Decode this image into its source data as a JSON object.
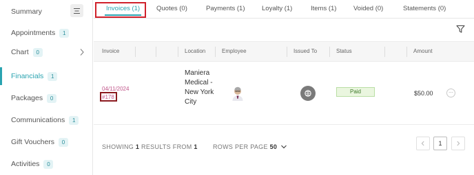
{
  "sidebar": {
    "items": [
      {
        "label": "Summary",
        "badge": null
      },
      {
        "label": "Appointments",
        "badge": "1"
      },
      {
        "label": "Chart",
        "badge": "0"
      },
      {
        "label": "Financials",
        "badge": "1",
        "active": true
      },
      {
        "label": "Packages",
        "badge": "0"
      },
      {
        "label": "Communications",
        "badge": "1"
      },
      {
        "label": "Gift Vouchers",
        "badge": "0"
      },
      {
        "label": "Activities",
        "badge": "0"
      }
    ],
    "toggle_icon": "collapse-menu-icon",
    "chart_chevron_icon": "chevron-right-icon"
  },
  "tabs": [
    {
      "label": "Invoices (1)",
      "active": true
    },
    {
      "label": "Quotes (0)"
    },
    {
      "label": "Payments (1)"
    },
    {
      "label": "Loyalty (1)"
    },
    {
      "label": "Items (1)"
    },
    {
      "label": "Voided (0)"
    },
    {
      "label": "Statements (0)"
    }
  ],
  "filter_icon": "filter-icon",
  "table": {
    "columns": [
      "Invoice",
      "Location",
      "Employee",
      "Issued To",
      "Status",
      "Amount"
    ],
    "rows": [
      {
        "invoice_date": "04/11/2024",
        "invoice_number": "#178",
        "location": "Maniera Medical - New York City",
        "employee_avatar": "employee-avatar",
        "issued_to_icon": "globe-icon",
        "status": "Paid",
        "amount": "$50.00"
      }
    ]
  },
  "footer": {
    "showing_prefix": "SHOWING",
    "results_count": "1",
    "results_from_label": "RESULTS FROM",
    "results_total": "1",
    "rows_per_page_label": "ROWS PER PAGE",
    "rows_per_page_value": "50",
    "current_page": "1"
  },
  "colors": {
    "accent": "#2aa3b0",
    "invoice_link": "#c0558a",
    "status_paid_bg": "#eaf6df",
    "highlight_red": "#d0202a"
  }
}
